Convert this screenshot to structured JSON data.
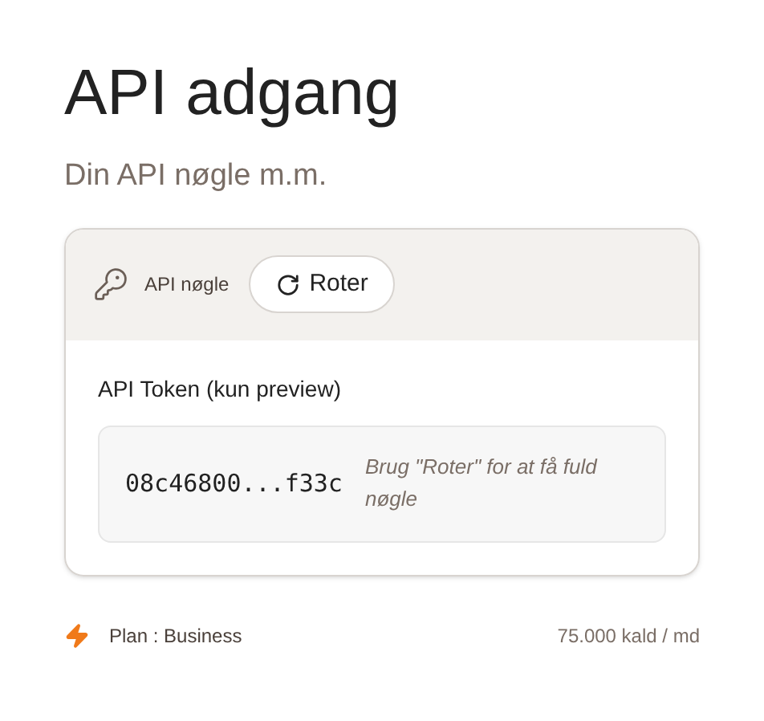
{
  "title": "API adgang",
  "subtitle": "Din API nøgle m.m.",
  "card": {
    "key_label": "API nøgle",
    "rotate_button": "Roter",
    "token_label": "API Token (kun preview)",
    "token": "08c46800...f33c",
    "hint": "Brug \"Roter\" for at få fuld nøgle"
  },
  "footer": {
    "plan": "Plan : Business",
    "quota": "75.000 kald / md"
  }
}
